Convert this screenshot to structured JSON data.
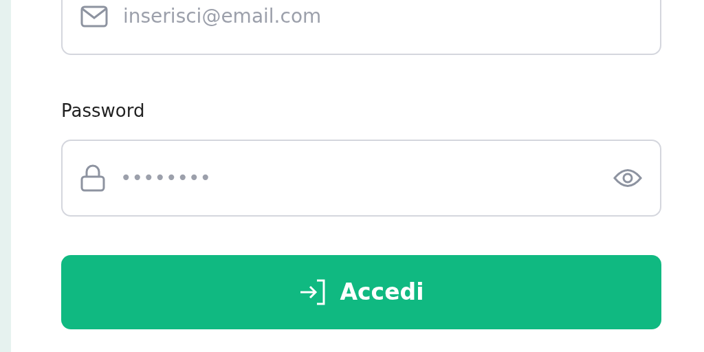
{
  "email_field": {
    "placeholder": "inserisci@email.com"
  },
  "password_field": {
    "label": "Password",
    "placeholder": "••••••••"
  },
  "submit_button": {
    "label": "Accedi"
  }
}
